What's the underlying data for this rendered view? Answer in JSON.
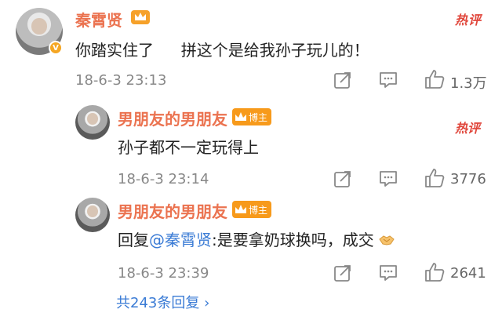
{
  "main_comment": {
    "username": "秦霄贤",
    "hot_label": "热评",
    "text_part1": "你踏实住了",
    "text_part2": "拼这个是给我孙子玩儿的！",
    "time": "18-6-3 23:13",
    "likes": "1.3万"
  },
  "replies": [
    {
      "username": "男朋友的男朋友",
      "tag": "博主",
      "hot_label": "热评",
      "text": "孙子都不一定玩得上",
      "time": "18-6-3 23:14",
      "likes": "3776"
    },
    {
      "username": "男朋友的男朋友",
      "tag": "博主",
      "reply_prefix": "回复",
      "mention": "@秦霄贤",
      "text": ":是要拿奶球换吗，成交",
      "time": "18-6-3 23:39",
      "likes": "2641"
    }
  ],
  "more_replies": "共243条回复 ›",
  "colors": {
    "username": "#eb7350",
    "hot": "#e0463b",
    "link": "#3a7bd5",
    "tag": "#f79a1b"
  },
  "icons": [
    "crown-icon",
    "share-icon",
    "comment-icon",
    "like-icon",
    "handshake-emoji"
  ]
}
